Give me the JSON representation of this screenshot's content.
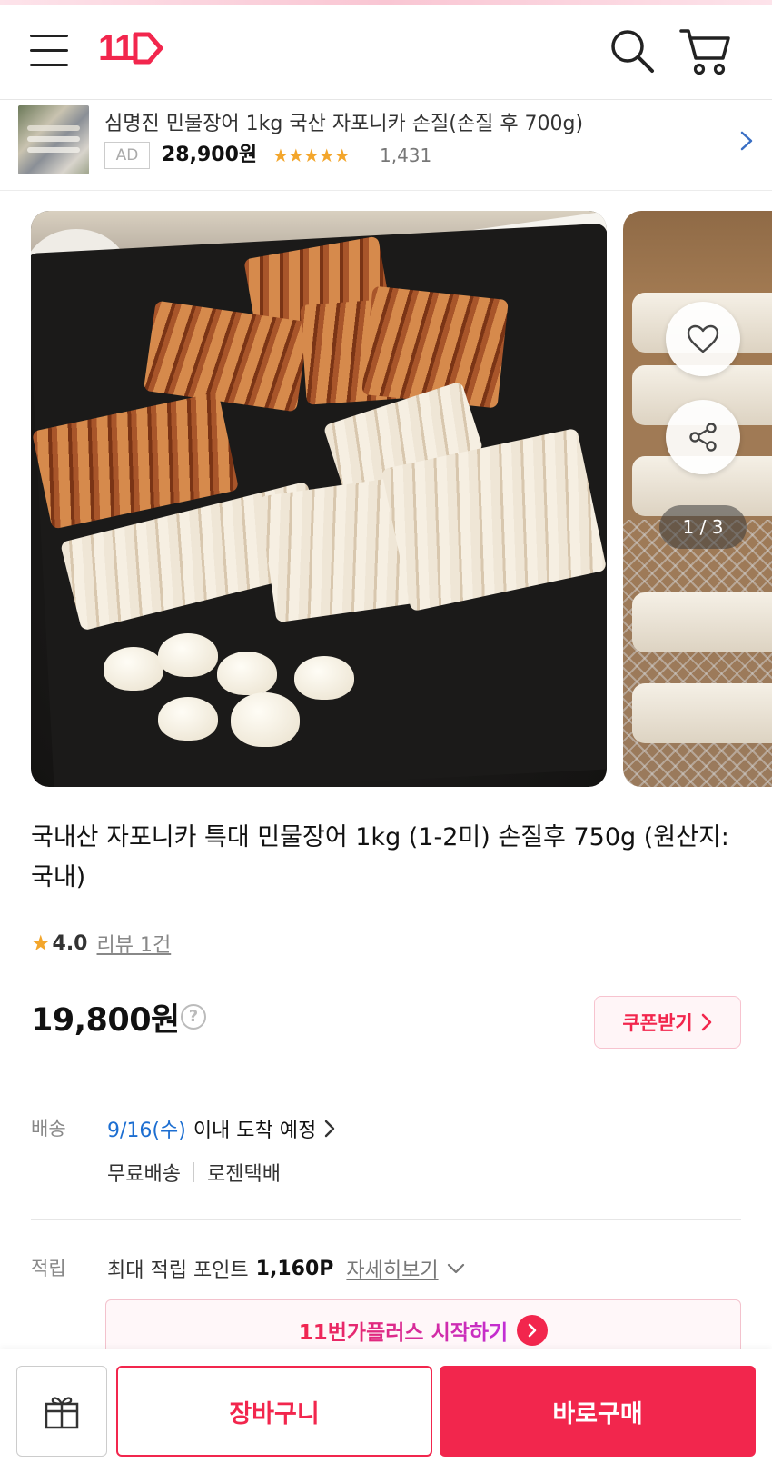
{
  "header": {
    "logo": "11"
  },
  "ad": {
    "title": "심명진 민물장어 1kg 국산 자포니카 손질(손질 후 700g)",
    "badge": "AD",
    "price": "28,900원",
    "stars": "★★★★★",
    "review_count": "1,431"
  },
  "gallery": {
    "pager": "1 / 3",
    "current_index": 1,
    "total": 3
  },
  "product": {
    "title": "국내산 자포니카 특대 민물장어 1kg (1-2미) 손질후 750g (원산지: 국내)",
    "rating_star": "★",
    "rating": "4.0",
    "review_link": "리뷰 1건",
    "price": "19,800원",
    "price_help": "?",
    "coupon_label": "쿠폰받기"
  },
  "shipping": {
    "label": "배송",
    "date": "9/16(수)",
    "date_suffix": "이내 도착 예정",
    "fee": "무료배송",
    "carrier": "로젠택배"
  },
  "points": {
    "label": "적립",
    "text": "최대 적립 포인트",
    "amount": "1,160P",
    "more": "자세히보기"
  },
  "plus_banner": {
    "text": "11번가플러스 시작하기"
  },
  "bottom": {
    "cart_label": "장바구니",
    "buy_label": "바로구매"
  },
  "colors": {
    "brand": "#f2264d",
    "star": "#f3a62c",
    "date_blue": "#1c6ed1"
  }
}
